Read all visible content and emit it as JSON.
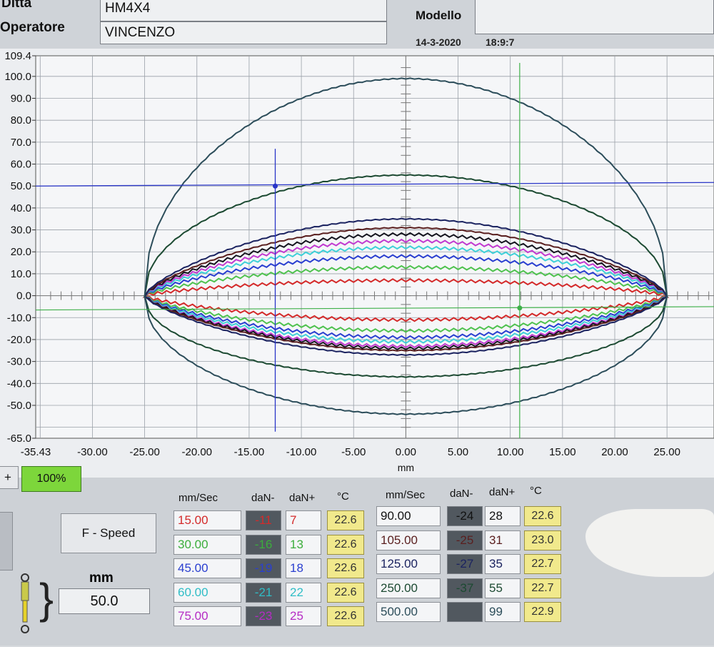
{
  "header": {
    "ditta_label": "Ditta",
    "ditta_value": "HM4X4",
    "operatore_label": "Operatore",
    "operatore_value": "VINCENZO",
    "modello_label": "Modello",
    "date": "14-3-2020",
    "time": "18:9:7"
  },
  "chart_data": {
    "type": "line",
    "xlabel": "mm",
    "ylabel": "",
    "xlim": [
      -35.43,
      25.0
    ],
    "ylim": [
      -65.0,
      109.4
    ],
    "x_ticks": [
      "-35.43",
      "-30.00",
      "-25.00",
      "-20.00",
      "-15.00",
      "-10.00",
      "-5.00",
      "0.00",
      "5.00",
      "10.00",
      "15.00",
      "20.00",
      "25.00"
    ],
    "y_ticks": [
      "109.4",
      "100.0",
      "90.0",
      "80.0",
      "70.0",
      "60.0",
      "50.0",
      "40.0",
      "30.0",
      "20.0",
      "10.0",
      "0.0",
      "-10.0",
      "-20.0",
      "-30.0",
      "-40.0",
      "-50.0",
      "-65.0"
    ],
    "x_range": [
      -25.0,
      25.0
    ],
    "grid": true,
    "cursor_x": -12.5,
    "cursor_y": 50.0,
    "series": [
      {
        "speed": 15.0,
        "peak_plus": 7,
        "peak_minus": -11,
        "color": "#d42a2a"
      },
      {
        "speed": 30.0,
        "peak_plus": 13,
        "peak_minus": -16,
        "color": "#4fc24f"
      },
      {
        "speed": 45.0,
        "peak_plus": 18,
        "peak_minus": -19,
        "color": "#2a3fd0"
      },
      {
        "speed": 60.0,
        "peak_plus": 22,
        "peak_minus": -21,
        "color": "#3fd0d8"
      },
      {
        "speed": 75.0,
        "peak_plus": 25,
        "peak_minus": -23,
        "color": "#c13ad0"
      },
      {
        "speed": 90.0,
        "peak_plus": 28,
        "peak_minus": -24,
        "color": "#15151f"
      },
      {
        "speed": 105.0,
        "peak_plus": 31,
        "peak_minus": -25,
        "color": "#5a1f1f"
      },
      {
        "speed": 125.0,
        "peak_plus": 35,
        "peak_minus": -27,
        "color": "#1b2360"
      },
      {
        "speed": 250.0,
        "peak_plus": 55,
        "peak_minus": -37,
        "color": "#1c4a32"
      },
      {
        "speed": 500.0,
        "peak_plus": 99,
        "peak_minus": -54,
        "color": "#2c4d5a"
      }
    ]
  },
  "controls": {
    "plus_label": "+",
    "zoom_label": "100%",
    "fspeed_label": "F - Speed",
    "mm_label": "mm",
    "mm_value": "50.0"
  },
  "table_headers": {
    "speed": "mm/Sec",
    "dn_minus": "daN-",
    "dn_plus": "daN+",
    "temp": "°C"
  },
  "table_left": [
    {
      "speed": "15.00",
      "dn_minus": "-11",
      "dn_plus": "7",
      "temp": "22.6",
      "color": "#d42a2a"
    },
    {
      "speed": "30.00",
      "dn_minus": "-16",
      "dn_plus": "13",
      "temp": "22.6",
      "color": "#3cae3c"
    },
    {
      "speed": "45.00",
      "dn_minus": "-19",
      "dn_plus": "18",
      "temp": "22.6",
      "color": "#2a3fd0"
    },
    {
      "speed": "60.00",
      "dn_minus": "-21",
      "dn_plus": "22",
      "temp": "22.6",
      "color": "#2fbdc6"
    },
    {
      "speed": "75.00",
      "dn_minus": "-23",
      "dn_plus": "25",
      "temp": "22.6",
      "color": "#b52cc4"
    }
  ],
  "table_right": [
    {
      "speed": "90.00",
      "dn_minus": "-24",
      "dn_plus": "28",
      "temp": "22.6",
      "color": "#111111"
    },
    {
      "speed": "105.00",
      "dn_minus": "-25",
      "dn_plus": "31",
      "temp": "23.0",
      "color": "#5a1f1f"
    },
    {
      "speed": "125.00",
      "dn_minus": "-27",
      "dn_plus": "35",
      "temp": "22.7",
      "color": "#1b2360"
    },
    {
      "speed": "250.00",
      "dn_minus": "-37",
      "dn_plus": "55",
      "temp": "22.7",
      "color": "#1c4a32"
    },
    {
      "speed": "500.00",
      "dn_minus": "",
      "dn_plus": "99",
      "temp": "22.9",
      "color": "#2c4d5a"
    }
  ]
}
